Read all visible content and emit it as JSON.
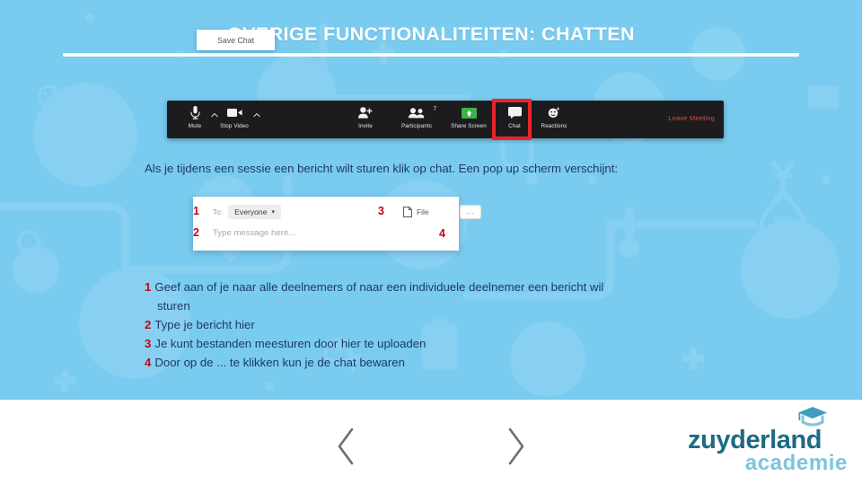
{
  "slide": {
    "title": "OVERIGE FUNCTIONALITEITEN: CHATTEN",
    "intro": "Als je tijdens een sessie een bericht wilt sturen klik op chat. Een pop up scherm verschijnt:",
    "background_color": "#79cbef",
    "accent_red": "#c00418",
    "text_color": "#1f3a63"
  },
  "toolbar": {
    "mute_label": "Mute",
    "stop_video_label": "Stop Video",
    "invite_label": "Invite",
    "participants_label": "Participants",
    "participants_count": "7",
    "share_screen_label": "Share Screen",
    "chat_label": "Chat",
    "reactions_label": "Reactions",
    "leave_label": "Leave Meeting",
    "highlight_color": "#e8262a",
    "leave_color": "#e8433e",
    "background": "#1c1c1e"
  },
  "chat_panel": {
    "to_label": "To:",
    "recipient": "Everyone",
    "message_placeholder": "Type message here...",
    "file_label": "File",
    "more_label": "...",
    "save_chat_label": "Save Chat",
    "marker_1": "1",
    "marker_2": "2",
    "marker_3": "3",
    "marker_4": "4"
  },
  "legend": {
    "items": [
      {
        "number": "1",
        "text": "Geef aan of je naar alle deelnemers of naar een individuele deelnemer een bericht wil",
        "continuation": "sturen"
      },
      {
        "number": "2",
        "text": "Type je bericht hier",
        "continuation": ""
      },
      {
        "number": "3",
        "text": "Je kunt bestanden meesturen door hier te uploaden",
        "continuation": ""
      },
      {
        "number": "4",
        "text": "Door op de ... te klikken kun je de chat bewaren",
        "continuation": ""
      }
    ]
  },
  "footer": {
    "prev_label": "Vorige",
    "next_label": "Volgende",
    "logo_primary": "zuyderland",
    "logo_secondary": "academie",
    "logo_primary_color": "#1d6a82",
    "logo_secondary_color": "#7cc4e0"
  }
}
